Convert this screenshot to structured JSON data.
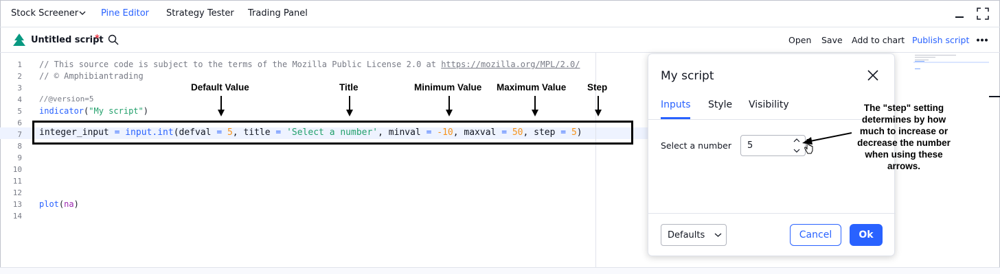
{
  "top_tabs": {
    "stock_screener": "Stock Screener",
    "pine_editor": "Pine Editor",
    "strategy_tester": "Strategy Tester",
    "trading_panel": "Trading Panel"
  },
  "toolbar": {
    "script_name": "Untitled script",
    "unsaved_marker": "*",
    "open": "Open",
    "save": "Save",
    "add_to_chart": "Add to chart",
    "publish": "Publish script"
  },
  "editor": {
    "line_numbers": [
      "1",
      "2",
      "3",
      "4",
      "5",
      "6",
      "7",
      "8",
      "9",
      "10",
      "11",
      "12",
      "13",
      "14"
    ],
    "line1_comment": "// This source code is subject to the terms of the Mozilla Public License 2.0 at ",
    "line1_url": "https://mozilla.org/MPL/2.0/",
    "line2": "// © Amphibiantrading",
    "line4": "//@version=5",
    "line5_fn": "indicator",
    "line5_open": "(",
    "line5_str": "\"My script\"",
    "line5_close": ")",
    "line7": {
      "var": "integer_input ",
      "eq1": "= ",
      "fn": "input.int",
      "p1": "(defval ",
      "eq2": "= ",
      "v1": "5",
      "p2": ", title ",
      "eq3": "= ",
      "v2": "'Select a number'",
      "p3": ", minval ",
      "eq4": "= ",
      "v3": "-10",
      "p4": ", maxval ",
      "eq5": "= ",
      "v4": "50",
      "p5": ", step ",
      "eq6": "= ",
      "v5": "5",
      "p6": ")"
    },
    "line13_fn": "plot",
    "line13_open": "(",
    "line13_arg": "na",
    "line13_close": ")"
  },
  "annotations": {
    "default_value": "Default Value",
    "title": "Title",
    "minimum_value": "Minimum Value",
    "maximum_value": "Maximum Value",
    "step": "Step",
    "step_note": "The \"step\" setting determines by how much to increase or decrease the number when using these arrows."
  },
  "dialog": {
    "title": "My script",
    "tabs": [
      "Inputs",
      "Style",
      "Visibility"
    ],
    "field_label": "Select a number",
    "field_value": "5",
    "defaults": "Defaults",
    "cancel": "Cancel",
    "ok": "Ok"
  },
  "colors": {
    "accent": "#2962ff",
    "string": "#22a06b",
    "number": "#f7931a",
    "comment": "#787b86",
    "unsaved": "#f23645",
    "logo": "#089981"
  },
  "icons": [
    "chevron-down-icon",
    "minimize-icon",
    "maximize-icon",
    "pine-logo-icon",
    "search-icon",
    "more-icon",
    "close-icon",
    "stepper-up-icon",
    "stepper-down-icon",
    "cursor-icon"
  ]
}
